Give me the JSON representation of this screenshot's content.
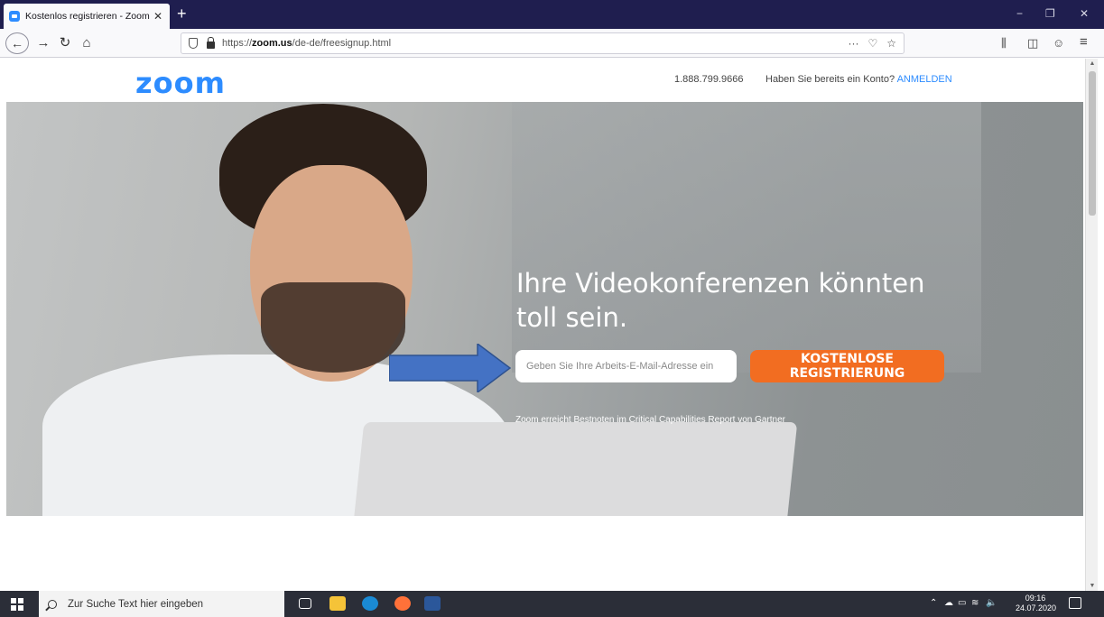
{
  "browser": {
    "tab_title": "Kostenlos registrieren - Zoom",
    "tab_close": "✕",
    "new_tab": "+",
    "url_prefix": "https://",
    "url_host": "zoom.us",
    "url_path": "/de-de/freesignup.html",
    "page_actions": "···",
    "window_controls": {
      "minimize": "−",
      "restore": "❐",
      "close": "✕"
    },
    "nav": {
      "back": "←",
      "forward": "→",
      "reload": "↻",
      "home": "⌂"
    },
    "toolbar_icons": {
      "library": "𝄃𝄃\\",
      "sidebar": "◫",
      "account": "☺",
      "menu": "≡"
    }
  },
  "site": {
    "logo": "zoom",
    "phone": "1.888.799.9666",
    "have_account": "Haben Sie bereits ein Konto?",
    "login_link": "ANMELDEN",
    "headline": "Ihre Videokonferenzen könnten toll sein.",
    "email_placeholder": "Geben Sie Ihre Arbeits-E-Mail-Adresse ein",
    "signup_button": "KOSTENLOSE REGISTRIERUNG",
    "gartner_note": "Zoom erreicht Bestnoten im Critical Capabilities Report von Gartner"
  },
  "colors": {
    "zoom_blue": "#2d8cff",
    "signup_orange": "#f26d21",
    "annotation_arrow": "#4472c4"
  },
  "taskbar": {
    "search_placeholder": "Zur Suche Text hier eingeben",
    "time": "09:16",
    "date": "24.07.2020",
    "apps": [
      "task-view-icon",
      "file-explorer-icon",
      "store-icon",
      "firefox-icon",
      "word-icon"
    ]
  }
}
